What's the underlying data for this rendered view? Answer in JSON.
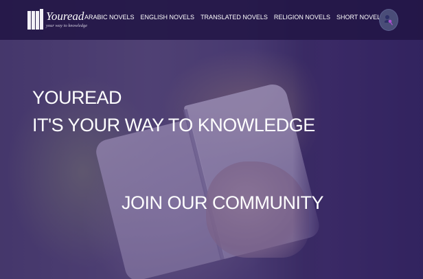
{
  "brand": {
    "name": "Youread",
    "tagline": "your way to knowledge",
    "logo_icon": "books-icon"
  },
  "nav": {
    "items": [
      {
        "label": "ARABIC NOVELS"
      },
      {
        "label": "ENGLISH NOVELS"
      },
      {
        "label": "TRANSLATED NOVELS"
      },
      {
        "label": "RELIGION NOVELS"
      },
      {
        "label": "SHORT NOVELS"
      }
    ]
  },
  "header": {
    "user_icon": "user-key-icon"
  },
  "hero": {
    "title": "YOUREAD",
    "subtitle": "IT'S YOUR WAY TO KNOWLEDGE",
    "cta_label": "JOIN OUR COMMUNITY"
  },
  "colors": {
    "header_bg": "#221646",
    "overlay": "#3c286e",
    "text": "#ffffff",
    "user_button": "#4a4d78",
    "user_icon_accent": "#b04fd6"
  }
}
